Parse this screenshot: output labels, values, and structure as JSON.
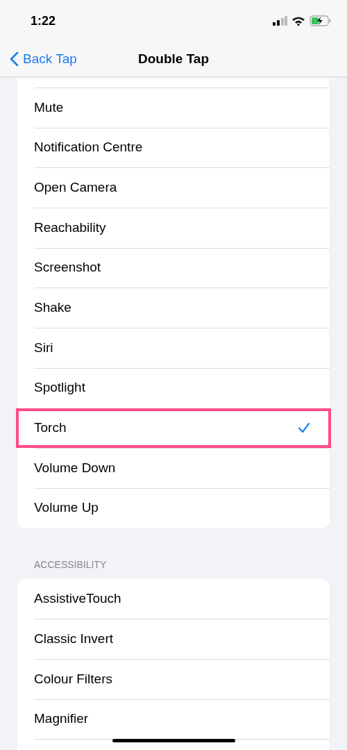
{
  "status_bar": {
    "time": "1:22"
  },
  "nav": {
    "back": "Back Tap",
    "title": "Double Tap"
  },
  "actions": [
    {
      "label": "Mute",
      "selected": false
    },
    {
      "label": "Notification Centre",
      "selected": false
    },
    {
      "label": "Open Camera",
      "selected": false
    },
    {
      "label": "Reachability",
      "selected": false
    },
    {
      "label": "Screenshot",
      "selected": false
    },
    {
      "label": "Shake",
      "selected": false
    },
    {
      "label": "Siri",
      "selected": false
    },
    {
      "label": "Spotlight",
      "selected": false
    },
    {
      "label": "Torch",
      "selected": true
    },
    {
      "label": "Volume Down",
      "selected": false
    },
    {
      "label": "Volume Up",
      "selected": false
    }
  ],
  "accessibility": {
    "header": "ACCESSIBILITY",
    "items": [
      {
        "label": "AssistiveTouch",
        "selected": false
      },
      {
        "label": "Classic Invert",
        "selected": false
      },
      {
        "label": "Colour Filters",
        "selected": false
      },
      {
        "label": "Magnifier",
        "selected": false
      }
    ]
  }
}
